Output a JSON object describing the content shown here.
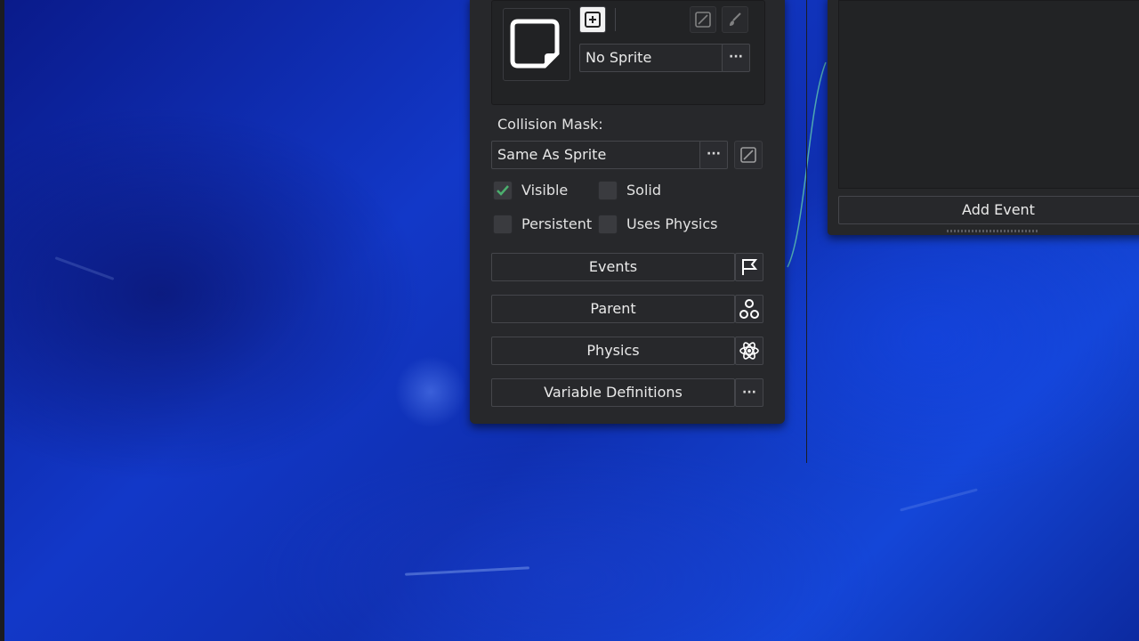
{
  "object_panel": {
    "sprite": {
      "value": "No Sprite",
      "more_label": "···"
    },
    "collision_mask": {
      "label": "Collision Mask:",
      "value": "Same As Sprite",
      "more_label": "···"
    },
    "checkboxes": [
      {
        "label": "Visible",
        "checked": true
      },
      {
        "label": "Solid",
        "checked": false
      },
      {
        "label": "Persistent",
        "checked": false
      },
      {
        "label": "Uses Physics",
        "checked": false
      }
    ],
    "buttons": [
      {
        "label": "Events",
        "icon": "flag-icon"
      },
      {
        "label": "Parent",
        "icon": "parent-hierarchy-icon"
      },
      {
        "label": "Physics",
        "icon": "physics-atom-icon"
      },
      {
        "label": "Variable Definitions",
        "icon": "more-dots-icon",
        "icon_text": "···"
      }
    ]
  },
  "events_panel": {
    "add_event_label": "Add Event"
  },
  "colors": {
    "panel_bg": "#27282b",
    "check_green": "#4caf6e",
    "curve": "#4fa8b0"
  }
}
